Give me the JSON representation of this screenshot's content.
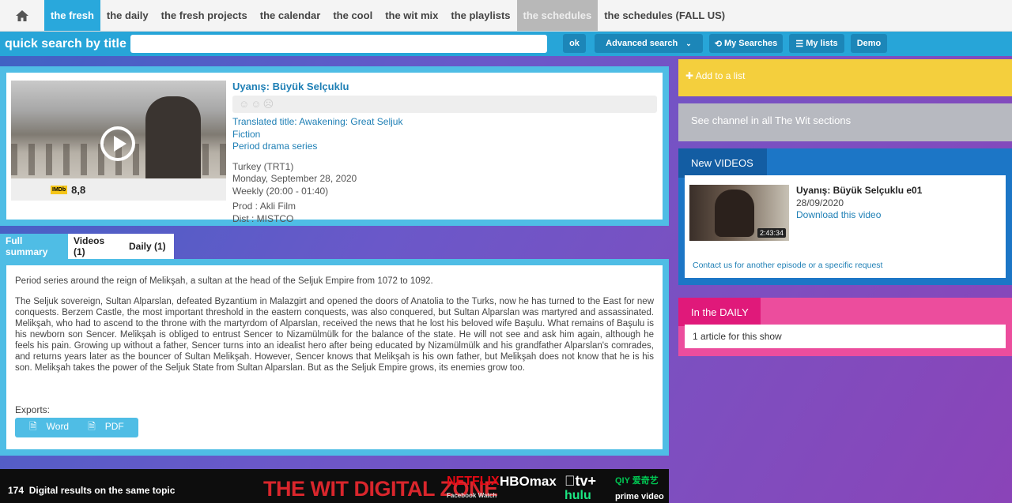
{
  "nav": {
    "items": [
      {
        "label": "the fresh",
        "state": "active"
      },
      {
        "label": "the daily",
        "state": ""
      },
      {
        "label": "the fresh projects",
        "state": ""
      },
      {
        "label": "the calendar",
        "state": ""
      },
      {
        "label": "the cool",
        "state": ""
      },
      {
        "label": "the wit mix",
        "state": ""
      },
      {
        "label": "the playlists",
        "state": ""
      },
      {
        "label": "the schedules",
        "state": "grey"
      },
      {
        "label": "the schedules (FALL US)",
        "state": ""
      }
    ]
  },
  "search": {
    "label": "quick search by title",
    "value": "",
    "ok_label": "ok",
    "advanced_label": "Advanced search",
    "my_searches_label": "My Searches",
    "my_lists_label": "My lists",
    "demo_label": "Demo"
  },
  "show": {
    "title": "Uyanış: Büyük Selçuklu",
    "imdb_label": "IMDb",
    "imdb_score": "8,8",
    "translated_title": "Translated title: Awakening: Great Seljuk",
    "genre": "Fiction",
    "subgenre": "Period drama series",
    "channel": "Turkey (TRT1)",
    "date": "Monday, September 28, 2020",
    "schedule": "Weekly (20:00 - 01:40)",
    "prod": "Prod : Akli Film",
    "dist": "Dist : MISTCO"
  },
  "tabs": [
    {
      "label": "Full summary"
    },
    {
      "label": "Videos (1)"
    },
    {
      "label": "Daily (1)"
    }
  ],
  "summary": {
    "p1": "Period series around the reign of Melikşah, a sultan at the head of the Seljuk Empire from 1072 to 1092.",
    "p2": "The Seljuk sovereign, Sultan Alparslan, defeated Byzantium in Malazgirt and opened the doors of Anatolia to the Turks, now he has turned to the East for new conquests. Berzem Castle, the most important threshold in the eastern conquests, was also conquered, but Sultan Alparslan was martyred and assassinated. Melikşah, who had to ascend to the throne with the martyrdom of Alparslan, received the news that he lost his beloved wife Başulu. What remains of Başulu is his newborn son Sencer. Melikşah is obliged to entrust Sencer to Nizamülmülk for the balance of the state. He will not see and ask him again, although he feels his pain. Growing up without a father, Sencer turns into an idealist hero after being educated by Nizamülmülk and his grandfather Alparslan's comrades, and returns years later as the bouncer of Sultan Melikşah. However, Sencer knows that Melikşah is his own father, but Melikşah does not know that he is his son. Melikşah takes the power of the Seljuk State from Sultan Alparslan. But as the Seljuk Empire grows, its enemies grow too.",
    "exports_label": "Exports:",
    "word_label": "Word",
    "pdf_label": "PDF"
  },
  "banner": {
    "count": "174",
    "count_text": "Digital results on the same topic",
    "zone_title": "THE WIT DIGITAL ZONE",
    "brands": [
      "NETFLIX",
      "HBOmax",
      "tv+",
      "QIY 爱奇艺",
      "Facebook Watch",
      "hulu",
      "prime video"
    ]
  },
  "right": {
    "add_list": "Add to a list",
    "see_channel": "See channel in all The Wit sections",
    "new_videos_header": "New VIDEOS",
    "video_title": "Uyanış: Büyük Selçuklu e01",
    "video_date": "28/09/2020",
    "video_download": "Download this video",
    "video_duration": "2:43:34",
    "video_contact": "Contact us for another episode or a specific request",
    "daily_header": "In the DAILY",
    "daily_text": "1 article for this show"
  }
}
